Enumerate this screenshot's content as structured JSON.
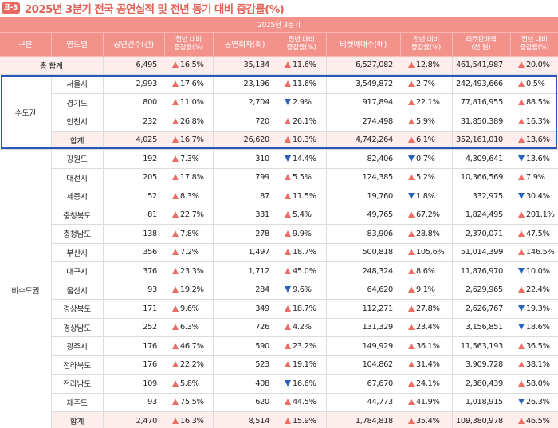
{
  "header": {
    "badge": "표-3",
    "title": "2025년 3분기 전국 공연실적 및 전년 동기 대비 증감률(%)"
  },
  "colors": {
    "header_bg": "#f2928b",
    "title": "#e26256",
    "up": "#ec6d63",
    "down": "#2862b8",
    "highlight_border": "#2a57b5",
    "total_bg": "#fdeeed"
  },
  "columns": {
    "quarter": "2025년 3분기",
    "group": "구분",
    "area": "연도별",
    "perf_count": "공연건수(건)",
    "change_line1": "전년 대비",
    "change_line2": "증감률(%)",
    "show_count": "공연회차(회)",
    "tickets": "티켓예매수(매)",
    "sales_line1": "티켓판매액",
    "sales_line2": "(천 원)"
  },
  "total_row": {
    "label": "총 합계",
    "perf": "6,495",
    "perf_dir": "up",
    "perf_rate": "16.5%",
    "show": "35,134",
    "show_dir": "up",
    "show_rate": "11.6%",
    "ticket": "6,527,082",
    "ticket_dir": "up",
    "ticket_rate": "12.8%",
    "sales": "461,541,987",
    "sales_dir": "up",
    "sales_rate": "20.0%"
  },
  "capital": {
    "region": "수도권",
    "rows": [
      {
        "name": "서울시",
        "perf": "2,993",
        "perf_dir": "up",
        "perf_rate": "17.6%",
        "show": "23,196",
        "show_dir": "up",
        "show_rate": "11.6%",
        "ticket": "3,549,872",
        "ticket_dir": "up",
        "ticket_rate": "2.7%",
        "sales": "242,493,666",
        "sales_dir": "up",
        "sales_rate": "0.5%"
      },
      {
        "name": "경기도",
        "perf": "800",
        "perf_dir": "up",
        "perf_rate": "11.0%",
        "show": "2,704",
        "show_dir": "down",
        "show_rate": "2.9%",
        "ticket": "917,894",
        "ticket_dir": "up",
        "ticket_rate": "22.1%",
        "sales": "77,816,955",
        "sales_dir": "up",
        "sales_rate": "88.5%"
      },
      {
        "name": "인천시",
        "perf": "232",
        "perf_dir": "up",
        "perf_rate": "26.8%",
        "show": "720",
        "show_dir": "up",
        "show_rate": "26.1%",
        "ticket": "274,498",
        "ticket_dir": "up",
        "ticket_rate": "5.9%",
        "sales": "31,850,389",
        "sales_dir": "up",
        "sales_rate": "16.3%"
      },
      {
        "name": "합계",
        "perf": "4,025",
        "perf_dir": "up",
        "perf_rate": "16.7%",
        "show": "26,620",
        "show_dir": "up",
        "show_rate": "10.3%",
        "ticket": "4,742,264",
        "ticket_dir": "up",
        "ticket_rate": "6.1%",
        "sales": "352,161,010",
        "sales_dir": "up",
        "sales_rate": "13.6%"
      }
    ]
  },
  "noncapital": {
    "region": "비수도권",
    "rows": [
      {
        "name": "강원도",
        "perf": "192",
        "perf_dir": "up",
        "perf_rate": "7.3%",
        "show": "310",
        "show_dir": "down",
        "show_rate": "14.4%",
        "ticket": "82,406",
        "ticket_dir": "down",
        "ticket_rate": "0.7%",
        "sales": "4,309,641",
        "sales_dir": "down",
        "sales_rate": "13.6%"
      },
      {
        "name": "대전시",
        "perf": "205",
        "perf_dir": "up",
        "perf_rate": "17.8%",
        "show": "799",
        "show_dir": "up",
        "show_rate": "5.5%",
        "ticket": "124,385",
        "ticket_dir": "up",
        "ticket_rate": "5.2%",
        "sales": "10,366,569",
        "sales_dir": "up",
        "sales_rate": "7.9%"
      },
      {
        "name": "세종시",
        "perf": "52",
        "perf_dir": "up",
        "perf_rate": "8.3%",
        "show": "87",
        "show_dir": "up",
        "show_rate": "11.5%",
        "ticket": "19,760",
        "ticket_dir": "down",
        "ticket_rate": "1.8%",
        "sales": "332,975",
        "sales_dir": "down",
        "sales_rate": "30.4%"
      },
      {
        "name": "충청북도",
        "perf": "81",
        "perf_dir": "up",
        "perf_rate": "22.7%",
        "show": "331",
        "show_dir": "up",
        "show_rate": "5.4%",
        "ticket": "49,765",
        "ticket_dir": "up",
        "ticket_rate": "67.2%",
        "sales": "1,824,495",
        "sales_dir": "up",
        "sales_rate": "201.1%"
      },
      {
        "name": "충청남도",
        "perf": "138",
        "perf_dir": "up",
        "perf_rate": "7.8%",
        "show": "278",
        "show_dir": "up",
        "show_rate": "9.9%",
        "ticket": "83,906",
        "ticket_dir": "up",
        "ticket_rate": "28.8%",
        "sales": "2,370,071",
        "sales_dir": "up",
        "sales_rate": "47.5%"
      },
      {
        "name": "부산시",
        "perf": "356",
        "perf_dir": "up",
        "perf_rate": "7.2%",
        "show": "1,497",
        "show_dir": "up",
        "show_rate": "18.7%",
        "ticket": "500,818",
        "ticket_dir": "up",
        "ticket_rate": "105.6%",
        "sales": "51,014,399",
        "sales_dir": "up",
        "sales_rate": "146.5%"
      },
      {
        "name": "대구시",
        "perf": "376",
        "perf_dir": "up",
        "perf_rate": "23.3%",
        "show": "1,712",
        "show_dir": "up",
        "show_rate": "45.0%",
        "ticket": "248,324",
        "ticket_dir": "up",
        "ticket_rate": "8.6%",
        "sales": "11,876,970",
        "sales_dir": "down",
        "sales_rate": "10.0%"
      },
      {
        "name": "울산시",
        "perf": "93",
        "perf_dir": "up",
        "perf_rate": "19.2%",
        "show": "284",
        "show_dir": "down",
        "show_rate": "9.6%",
        "ticket": "64,620",
        "ticket_dir": "up",
        "ticket_rate": "9.1%",
        "sales": "2,629,965",
        "sales_dir": "up",
        "sales_rate": "22.4%"
      },
      {
        "name": "경상북도",
        "perf": "171",
        "perf_dir": "up",
        "perf_rate": "9.6%",
        "show": "349",
        "show_dir": "up",
        "show_rate": "18.7%",
        "ticket": "112,271",
        "ticket_dir": "up",
        "ticket_rate": "27.8%",
        "sales": "2,626,767",
        "sales_dir": "down",
        "sales_rate": "19.3%"
      },
      {
        "name": "경상남도",
        "perf": "252",
        "perf_dir": "up",
        "perf_rate": "6.3%",
        "show": "726",
        "show_dir": "up",
        "show_rate": "4.2%",
        "ticket": "131,329",
        "ticket_dir": "up",
        "ticket_rate": "23.4%",
        "sales": "3,156,851",
        "sales_dir": "down",
        "sales_rate": "18.6%"
      },
      {
        "name": "광주시",
        "perf": "176",
        "perf_dir": "up",
        "perf_rate": "46.7%",
        "show": "590",
        "show_dir": "up",
        "show_rate": "23.2%",
        "ticket": "149,929",
        "ticket_dir": "up",
        "ticket_rate": "36.1%",
        "sales": "11,563,193",
        "sales_dir": "up",
        "sales_rate": "36.5%"
      },
      {
        "name": "전라북도",
        "perf": "176",
        "perf_dir": "up",
        "perf_rate": "22.2%",
        "show": "523",
        "show_dir": "up",
        "show_rate": "19.1%",
        "ticket": "104,862",
        "ticket_dir": "up",
        "ticket_rate": "31.4%",
        "sales": "3,909,728",
        "sales_dir": "up",
        "sales_rate": "38.1%"
      },
      {
        "name": "전라남도",
        "perf": "109",
        "perf_dir": "up",
        "perf_rate": "5.8%",
        "show": "408",
        "show_dir": "down",
        "show_rate": "16.6%",
        "ticket": "67,670",
        "ticket_dir": "up",
        "ticket_rate": "24.1%",
        "sales": "2,380,439",
        "sales_dir": "up",
        "sales_rate": "58.0%"
      },
      {
        "name": "제주도",
        "perf": "93",
        "perf_dir": "up",
        "perf_rate": "75.5%",
        "show": "620",
        "show_dir": "up",
        "show_rate": "44.5%",
        "ticket": "44,773",
        "ticket_dir": "up",
        "ticket_rate": "41.9%",
        "sales": "1,018,915",
        "sales_dir": "down",
        "sales_rate": "26.3%"
      },
      {
        "name": "합계",
        "perf": "2,470",
        "perf_dir": "up",
        "perf_rate": "16.3%",
        "show": "8,514",
        "show_dir": "up",
        "show_rate": "15.9%",
        "ticket": "1,784,818",
        "ticket_dir": "up",
        "ticket_rate": "35.4%",
        "sales": "109,380,978",
        "sales_dir": "up",
        "sales_rate": "46.5%"
      }
    ]
  }
}
